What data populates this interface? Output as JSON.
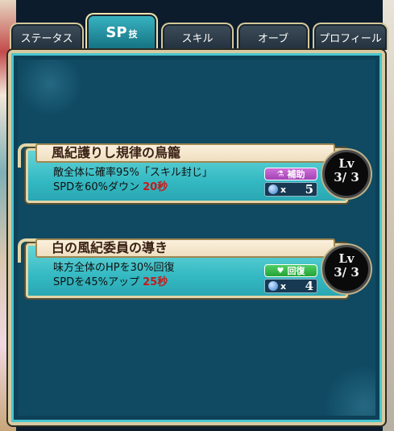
{
  "tabs": [
    {
      "label": "ステータス"
    },
    {
      "label": "SP",
      "suffix": "技"
    },
    {
      "label": "スキル"
    },
    {
      "label": "オーブ"
    },
    {
      "label": "プロフィール"
    }
  ],
  "active_tab": "SP技",
  "skills": [
    {
      "name": "風紀護りし規律の鳥籠",
      "desc_line1": "敵全体に確率95%「スキル封じ」",
      "desc_line2": "SPDを60%ダウン",
      "duration": "20秒",
      "tag": "補助",
      "tag_icon": "flask-icon",
      "cost_x": "x",
      "cost": "5",
      "level_label": "Lv",
      "level": "3/ 3"
    },
    {
      "name": "白の風紀委員の導き",
      "desc_line1": "味方全体のHPを30%回復",
      "desc_line2": "SPDを45%アップ",
      "duration": "25秒",
      "tag": "回復",
      "tag_icon": "heart-icon",
      "cost_x": "x",
      "cost": "4",
      "level_label": "Lv",
      "level": "3/ 3"
    }
  ],
  "colors": {
    "panel": "#0f4a62",
    "card": "#34b9c2",
    "accent_border": "#e2d6a8",
    "duration": "#c81818",
    "support_tag": "#a243b5",
    "heal_tag": "#23a336"
  }
}
